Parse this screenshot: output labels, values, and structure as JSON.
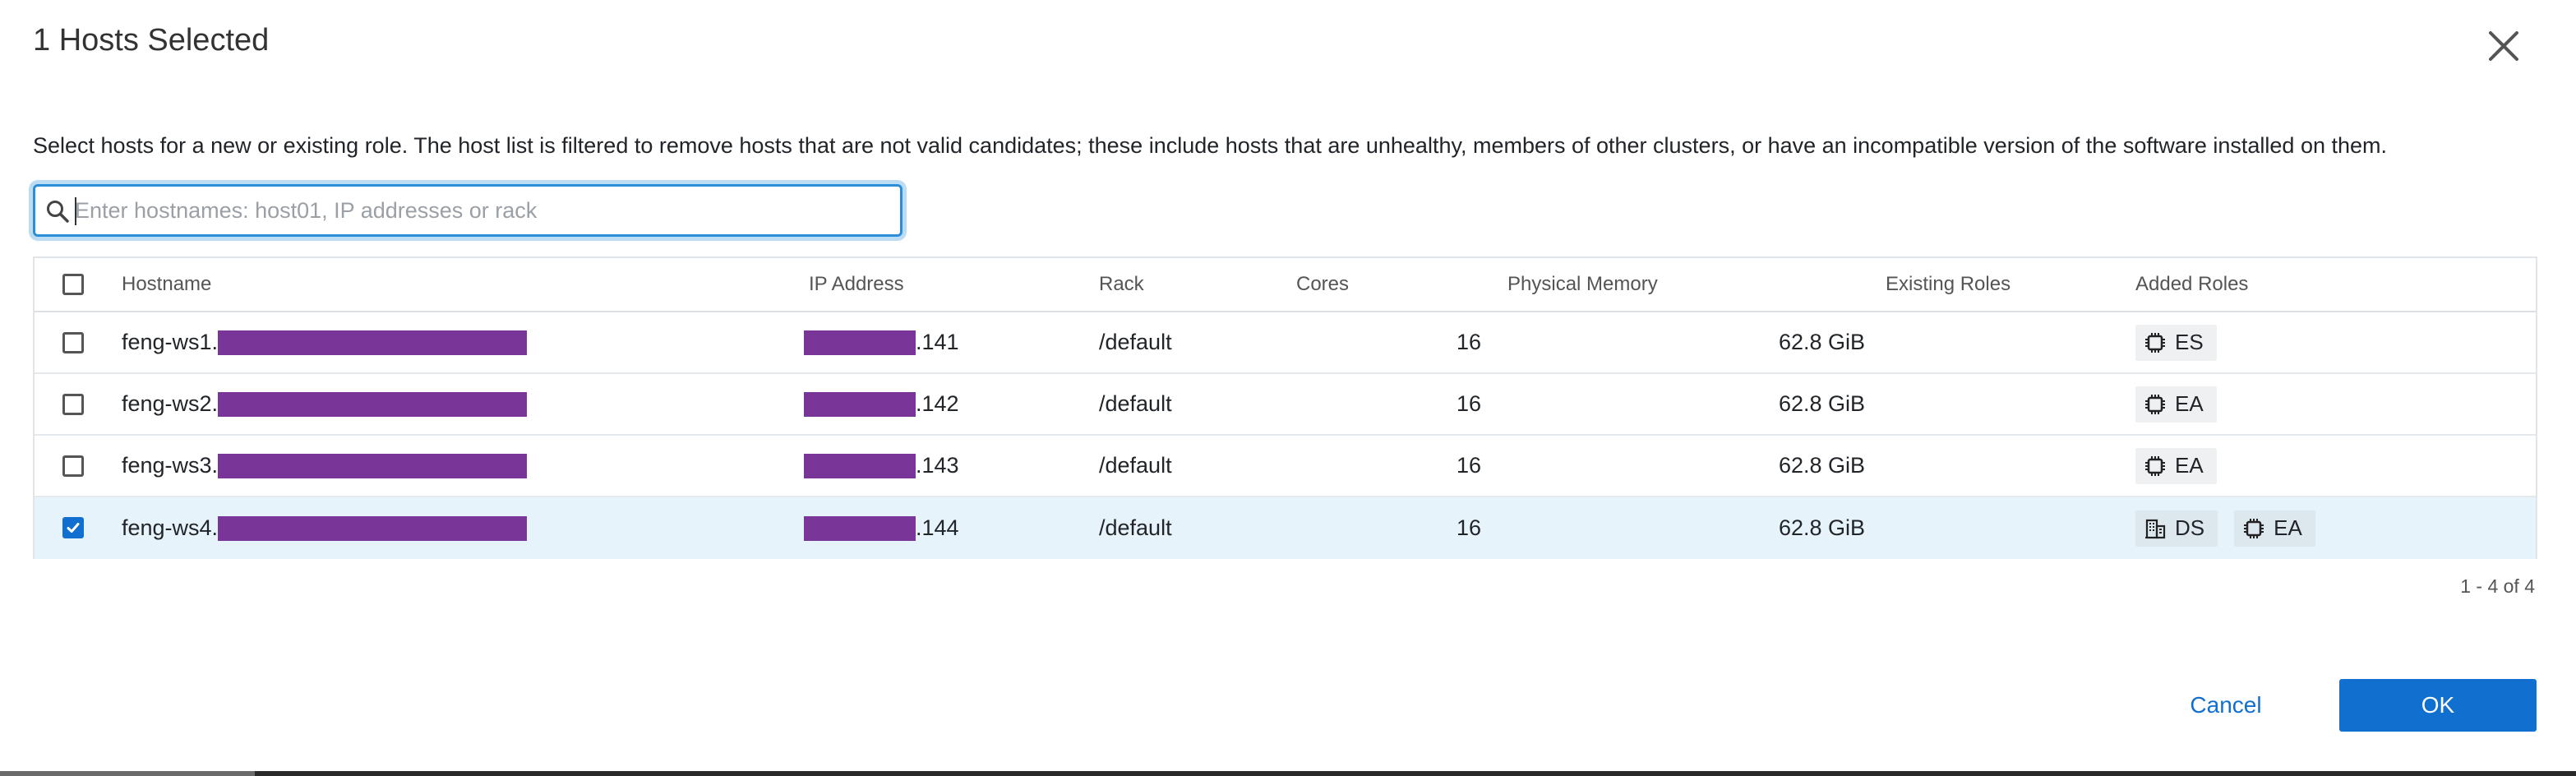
{
  "dialog": {
    "title": "1 Hosts Selected",
    "description": "Select hosts for a new or existing role. The host list is filtered to remove hosts that are not valid candidates; these include hosts that are unhealthy, members of other clusters, or have an incompatible version of the software installed on them."
  },
  "search": {
    "placeholder": "Enter hostnames: host01, IP addresses or rack",
    "value": ""
  },
  "table": {
    "columns": [
      "Hostname",
      "IP Address",
      "Rack",
      "Cores",
      "Physical Memory",
      "Existing Roles",
      "Added Roles"
    ],
    "rows": [
      {
        "hostname": "feng-ws1.",
        "ip": ".141",
        "rack": "/default",
        "cores": "16",
        "memory": "62.8 GiB",
        "existing_roles": [],
        "added_roles": [
          {
            "icon": "chip-icon",
            "label": "ES"
          }
        ],
        "checked": false
      },
      {
        "hostname": "feng-ws2.",
        "ip": ".142",
        "rack": "/default",
        "cores": "16",
        "memory": "62.8 GiB",
        "existing_roles": [],
        "added_roles": [
          {
            "icon": "chip-icon",
            "label": "EA"
          }
        ],
        "checked": false
      },
      {
        "hostname": "feng-ws3.",
        "ip": ".143",
        "rack": "/default",
        "cores": "16",
        "memory": "62.8 GiB",
        "existing_roles": [],
        "added_roles": [
          {
            "icon": "chip-icon",
            "label": "EA"
          }
        ],
        "checked": false
      },
      {
        "hostname": "feng-ws4.",
        "ip": ".144",
        "rack": "/default",
        "cores": "16",
        "memory": "62.8 GiB",
        "existing_roles": [],
        "added_roles": [
          {
            "icon": "building-icon",
            "label": "DS"
          },
          {
            "icon": "chip-icon",
            "label": "EA"
          }
        ],
        "checked": true
      }
    ]
  },
  "pagination": {
    "text": "1 - 4 of 4"
  },
  "footer": {
    "cancel_label": "Cancel",
    "ok_label": "OK"
  },
  "colors": {
    "accent": "#1170cf",
    "redaction": "#7a3599",
    "selected_row": "#e7f3fb",
    "focus_ring": "#2a8fd8"
  }
}
